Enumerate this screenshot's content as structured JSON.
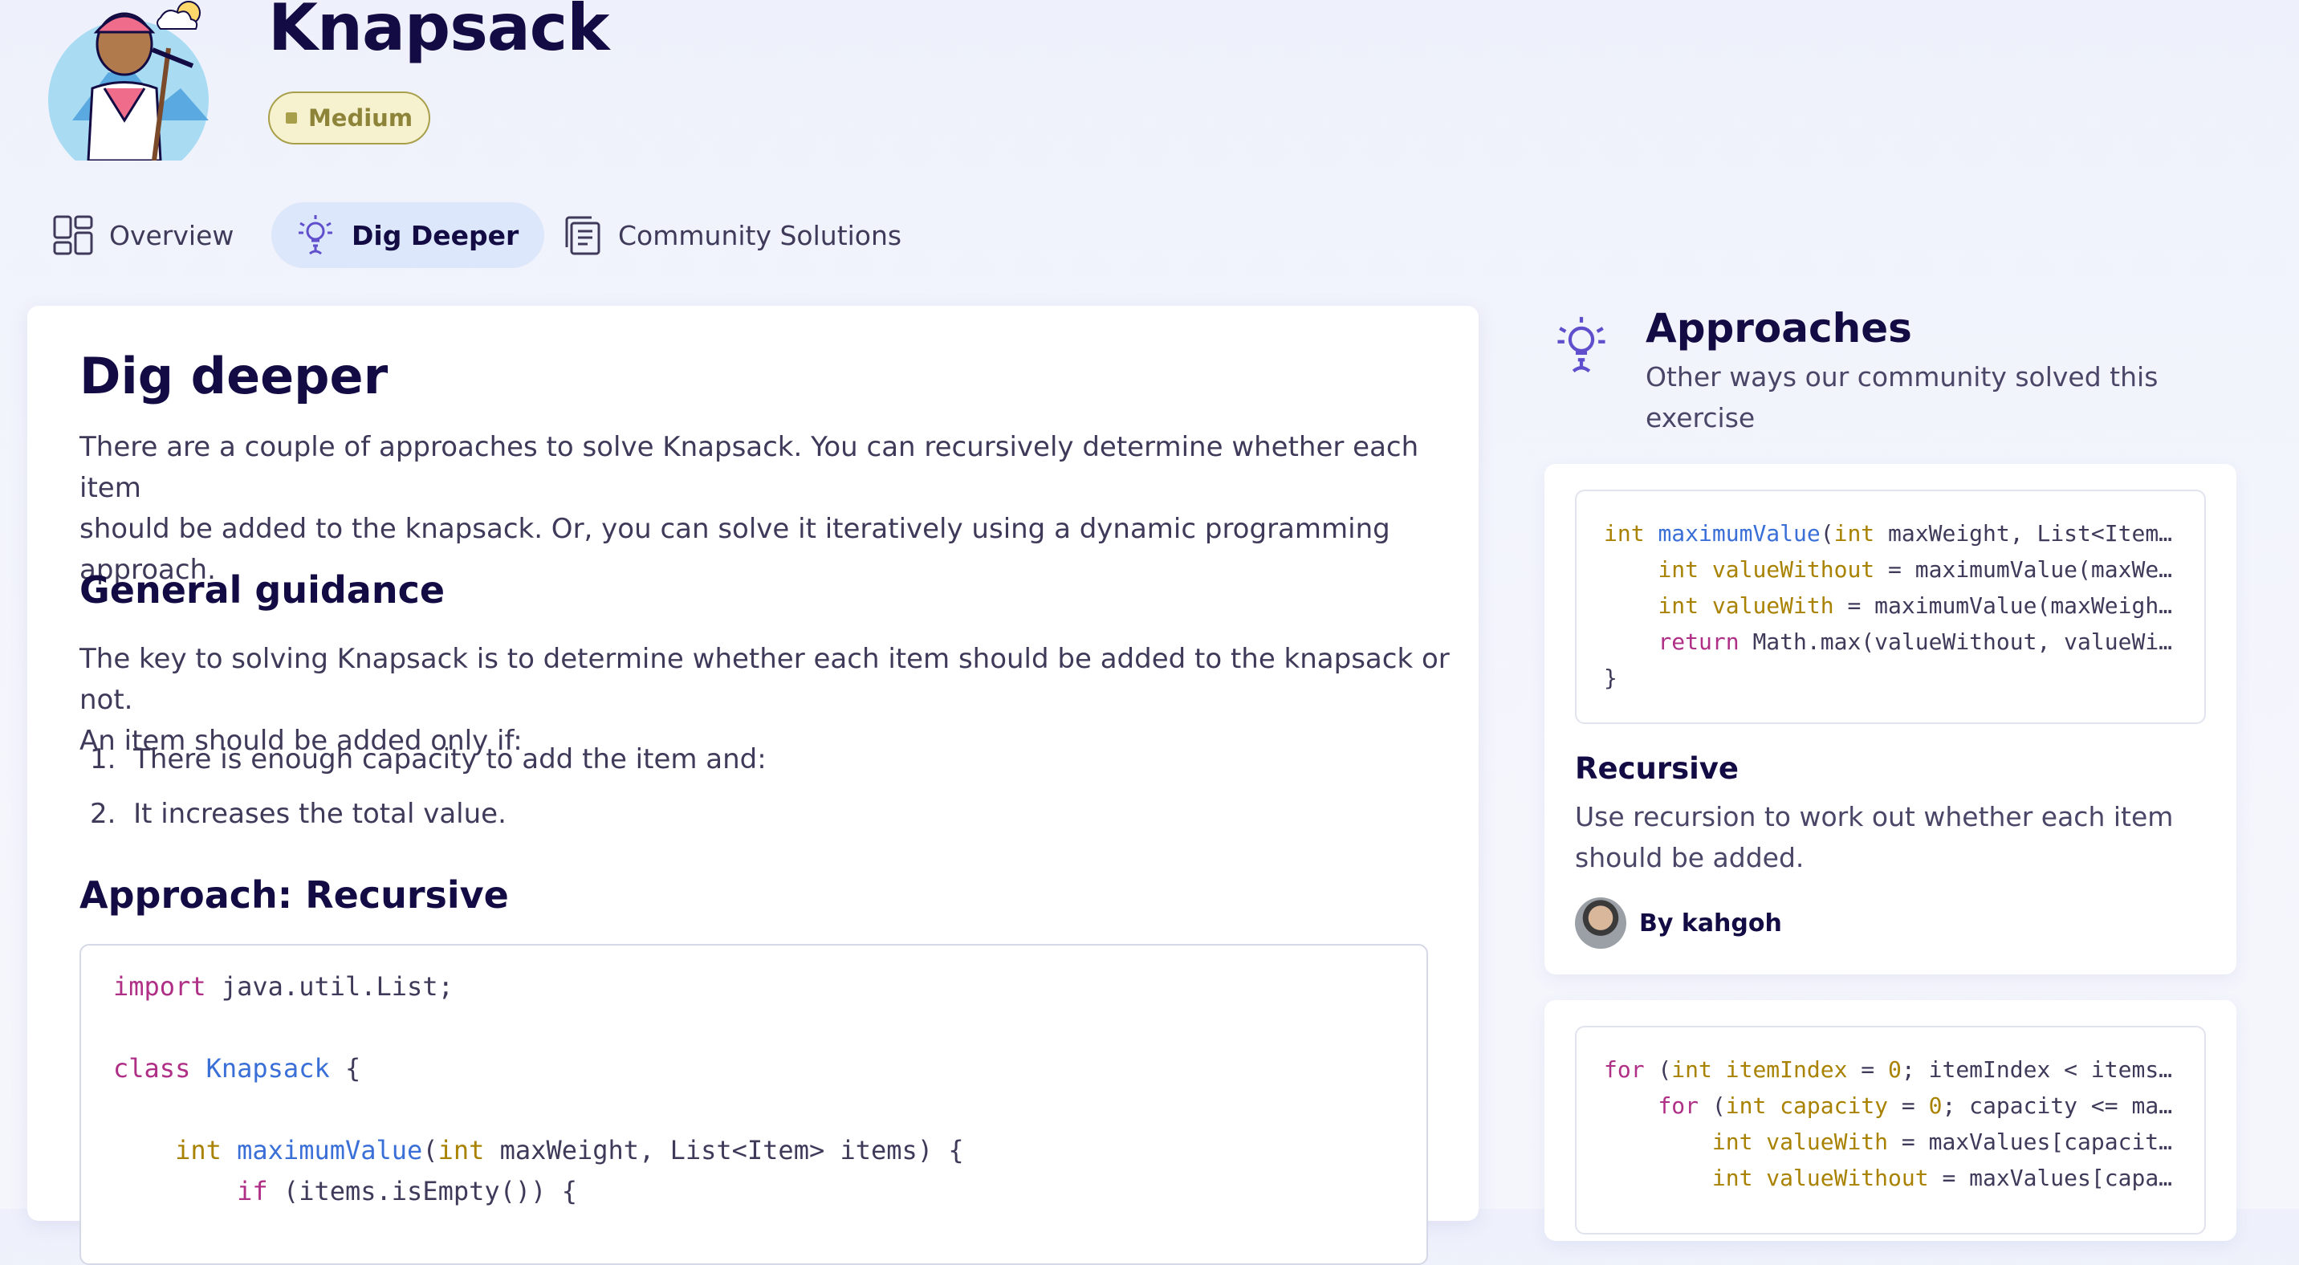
{
  "header": {
    "title": "Knapsack",
    "difficulty": "Medium"
  },
  "tabs": [
    {
      "label": "Overview",
      "icon": "overview-icon",
      "active": false
    },
    {
      "label": "Dig Deeper",
      "icon": "lightbulb-icon",
      "active": true
    },
    {
      "label": "Community Solutions",
      "icon": "community-solutions-icon",
      "active": false
    }
  ],
  "main": {
    "heading": "Dig deeper",
    "intro_lines": [
      "There are a couple of approaches to solve Knapsack. You can recursively determine whether each item",
      "should be added to the knapsack. Or, you can solve it iteratively using a dynamic programming",
      "approach."
    ],
    "guidance_heading": "General guidance",
    "guidance_lines": [
      "The key to solving Knapsack is to determine whether each item should be added to the knapsack or not.",
      "An item should be added only if:"
    ],
    "list": [
      "There is enough capacity to add the item and:",
      "It increases the total value."
    ],
    "approach_heading": "Approach: Recursive"
  },
  "sidebar": {
    "title": "Approaches",
    "subtitle_lines": [
      "Other ways our community solved this",
      "exercise"
    ],
    "cards": [
      {
        "title": "Recursive",
        "desc_lines": [
          "Use recursion to work out whether each item",
          "should be added."
        ],
        "author": "By kahgoh"
      }
    ]
  },
  "colors": {
    "accent": "#604fcd",
    "tab_active_bg": "#dde7fb",
    "badge_text": "#8d8439",
    "keyword": "#b02f86",
    "type": "#a88200",
    "function": "#3a6fd8"
  }
}
